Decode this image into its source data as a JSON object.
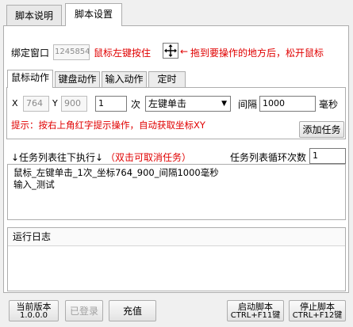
{
  "tabs": [
    {
      "label": "脚本说明"
    },
    {
      "label": "脚本设置"
    }
  ],
  "bind": {
    "label": "绑定窗口",
    "window_value": "1245854",
    "hint_left": "鼠标左键按住",
    "hint_right": "拖到要操作的地方后，松开鼠标"
  },
  "subtabs": [
    {
      "label": "鼠标动作"
    },
    {
      "label": "键盘动作"
    },
    {
      "label": "输入动作"
    },
    {
      "label": "定时"
    }
  ],
  "mouse": {
    "x_label": "X",
    "x_value": "764",
    "y_label": "Y",
    "y_value": "900",
    "count_value": "1",
    "count_unit": "次",
    "action_selected": "左键单击",
    "interval_label": "间隔",
    "interval_value": "1000",
    "interval_unit": "毫秒",
    "tip": "提示：按右上角红字提示操作，自动获取坐标XY",
    "add_button": "添加任务"
  },
  "tasks": {
    "header": "↓任务列表往下执行↓",
    "cancel_hint": "（双击可取消任务）",
    "loop_label": "任务列表循环次数",
    "loop_value": "1",
    "items": [
      "鼠标_左键单击_1次_坐标764_900_间隔1000毫秒",
      "输入_测试"
    ]
  },
  "log": {
    "title": "运行日志"
  },
  "footer": {
    "version_line1": "当前版本",
    "version_line2": "1.0.0.0",
    "logged_in": "已登录",
    "recharge": "充值",
    "start_line1": "启动脚本",
    "start_line2": "CTRL+F11键",
    "stop_line1": "停止脚本",
    "stop_line2": "CTRL+F12键"
  }
}
